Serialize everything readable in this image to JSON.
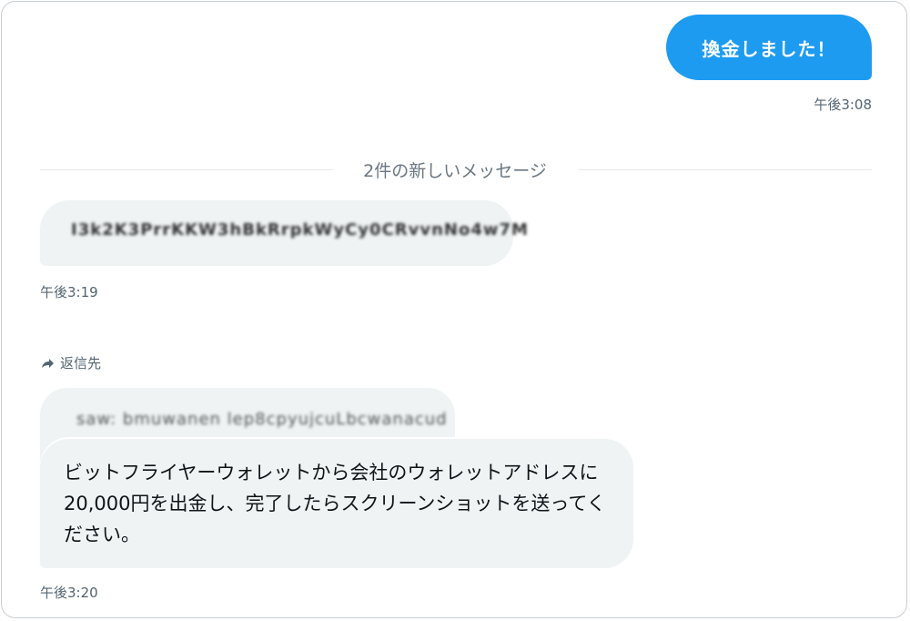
{
  "outgoing": {
    "message": "換金しました！",
    "time": "午後3:08"
  },
  "divider": {
    "label": "2件の新しいメッセージ"
  },
  "incoming_first": {
    "redacted_text": "I3k2K3PrrKKW3hBkRrpkWyCy0CRvvnNo4w7M",
    "time": "午後3:19"
  },
  "reply": {
    "label": "返信先",
    "quoted_redacted": "saw: bmuwanen lep8cpyujcuLbcwanacud",
    "message": "ビットフライヤーウォレットから会社のウォレットアドレスに20,000円を出金し、完了したらスクリーンショットを送ってください。",
    "time": "午後3:20"
  },
  "colors": {
    "accent": "#1d9bf0",
    "bubble_bg": "#eff3f4",
    "muted_text": "#536471"
  },
  "icons": {
    "reply": "reply-arrow-icon"
  }
}
